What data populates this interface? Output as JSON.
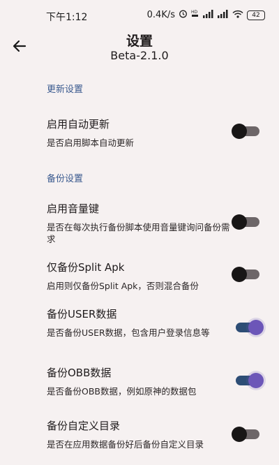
{
  "status_bar": {
    "time": "下午1:12",
    "net_speed": "0.4K/s",
    "battery": "42"
  },
  "header": {
    "title": "设置",
    "version": "Beta-2.1.0"
  },
  "sections": [
    {
      "label": "更新设置",
      "items": [
        {
          "title": "启用自动更新",
          "desc": "是否启用脚本自动更新",
          "enabled": false
        }
      ]
    },
    {
      "label": "备份设置",
      "items": [
        {
          "title": "启用音量键",
          "desc": "是否在每次执行备份脚本使用音量键询问备份需求",
          "enabled": false
        },
        {
          "title": "仅备份Split Apk",
          "desc": "启用则仅备份Split Apk，否则混合备份",
          "enabled": false
        },
        {
          "title": "备份USER数据",
          "desc": "是否备份USER数据，包含用户登录信息等",
          "enabled": true
        },
        {
          "title": "备份OBB数据",
          "desc": "是否备份OBB数据，例如原神的数据包",
          "enabled": true
        },
        {
          "title": "备份自定义目录",
          "desc": "是否在应用数据备份好后备份自定义目录",
          "enabled": false
        }
      ]
    }
  ],
  "colors": {
    "background": "#f6f1f1",
    "section_label": "#3a5a8f",
    "switch_on_track": "#2d4d75",
    "switch_on_knob": "#6c56b8",
    "switch_off_track": "#6d6668",
    "switch_off_knob": "#181616"
  }
}
